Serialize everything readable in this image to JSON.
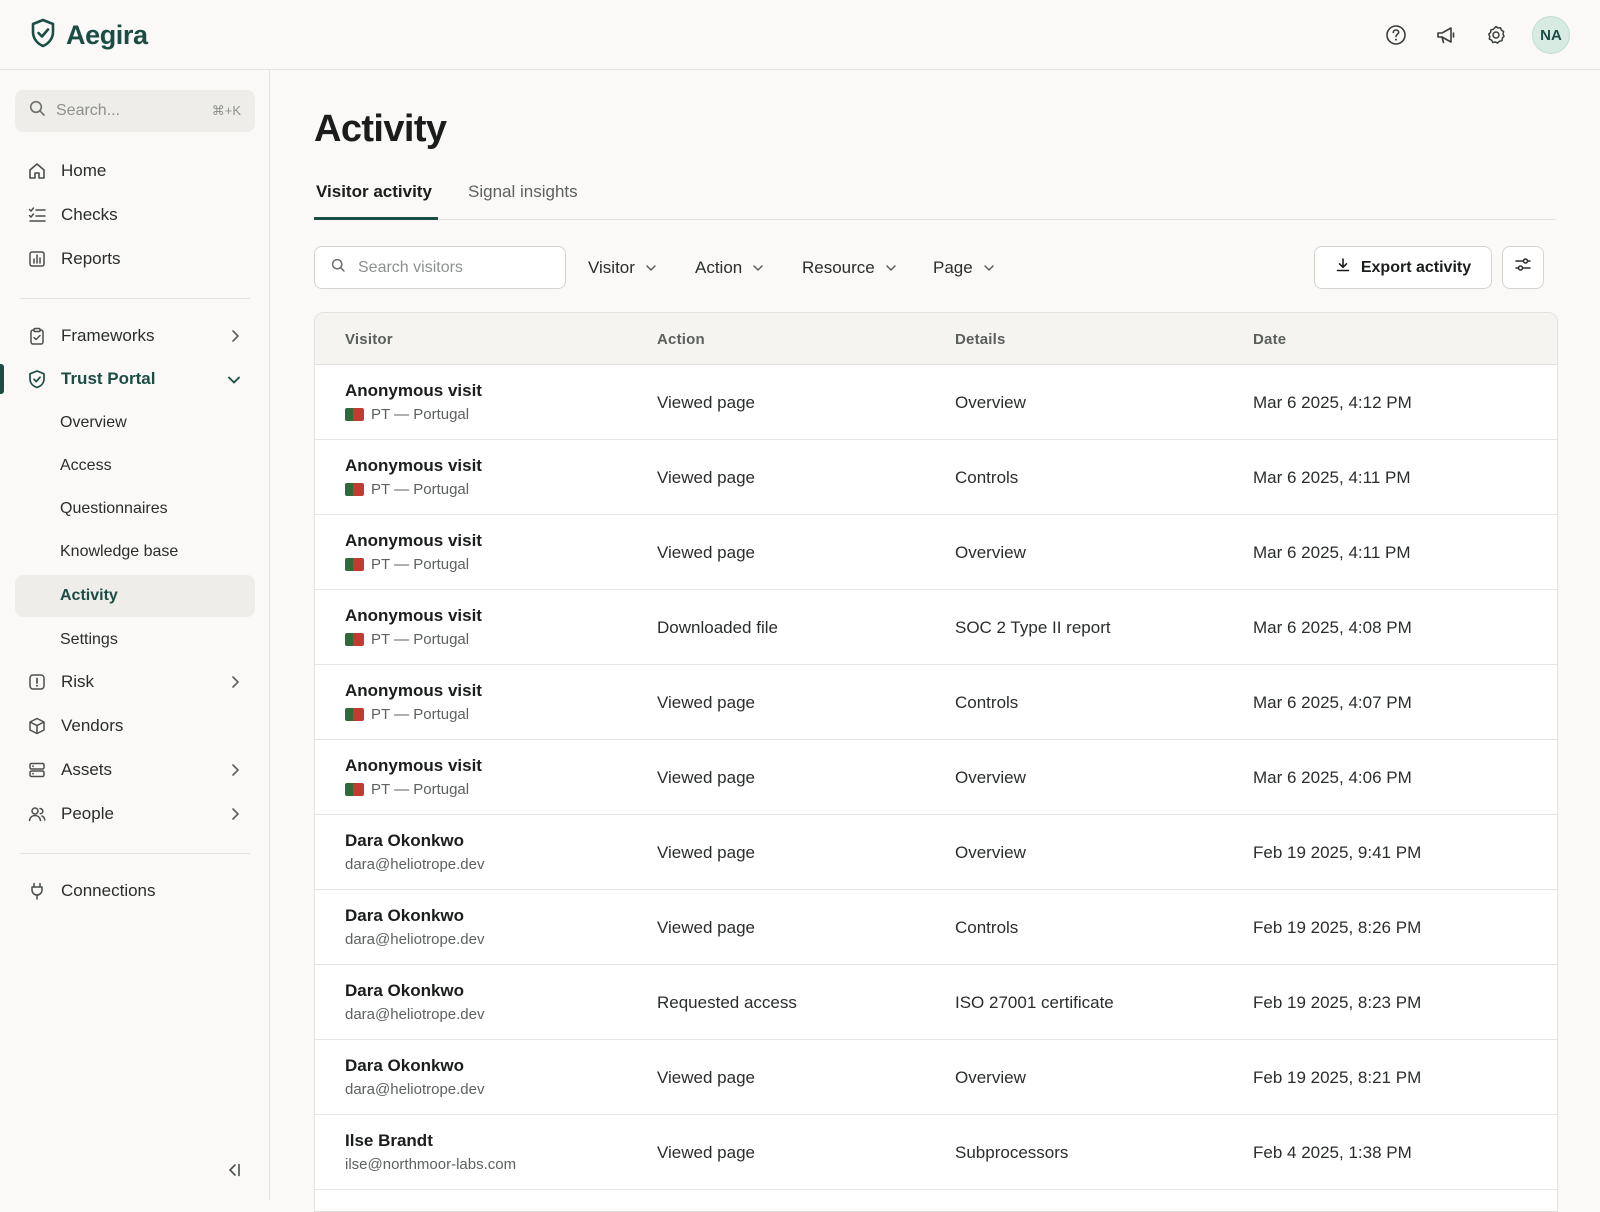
{
  "app": {
    "name": "Aegira",
    "avatar_initials": "NA"
  },
  "header_icons": [
    "help-icon",
    "megaphone-icon",
    "settings-icon"
  ],
  "sidebar": {
    "search_placeholder": "Search...",
    "search_shortcut": "⌘+K",
    "items": [
      {
        "label": "Home",
        "icon": "home-icon"
      },
      {
        "label": "Checks",
        "icon": "checklist-icon"
      },
      {
        "label": "Reports",
        "icon": "chart-icon"
      },
      {
        "label": "Frameworks",
        "icon": "clipboard-icon"
      },
      {
        "label": "Trust Portal",
        "icon": "shield-icon"
      },
      {
        "label": "Risk",
        "icon": "alert-icon"
      },
      {
        "label": "Vendors",
        "icon": "box-icon"
      },
      {
        "label": "Assets",
        "icon": "server-icon"
      },
      {
        "label": "People",
        "icon": "users-icon"
      },
      {
        "label": "Connections",
        "icon": "plug-icon"
      }
    ],
    "trust_portal_children": [
      "Overview",
      "Access",
      "Questionnaires",
      "Knowledge base",
      "Activity",
      "Settings"
    ],
    "active_child": "Activity"
  },
  "main": {
    "title": "Activity",
    "tabs": [
      {
        "label": "Visitor activity",
        "active": true
      },
      {
        "label": "Signal insights",
        "active": false
      }
    ],
    "toolbar": {
      "search_placeholder": "Search visitors",
      "filters": [
        "Visitor",
        "Action",
        "Resource",
        "Page"
      ],
      "export_label": "Export activity"
    },
    "table": {
      "columns": [
        "Visitor",
        "Action",
        "Details",
        "Date"
      ],
      "rows": [
        {
          "name": "Anonymous visit",
          "sub": "PT — Portugal",
          "flag": true,
          "action": "Viewed page",
          "details": "Overview",
          "date": "Mar 6 2025, 4:12 PM"
        },
        {
          "name": "Anonymous visit",
          "sub": "PT — Portugal",
          "flag": true,
          "action": "Viewed page",
          "details": "Controls",
          "date": "Mar 6 2025, 4:11 PM"
        },
        {
          "name": "Anonymous visit",
          "sub": "PT — Portugal",
          "flag": true,
          "action": "Viewed page",
          "details": "Overview",
          "date": "Mar 6 2025, 4:11 PM"
        },
        {
          "name": "Anonymous visit",
          "sub": "PT — Portugal",
          "flag": true,
          "action": "Downloaded file",
          "details": "SOC 2 Type II report",
          "date": "Mar 6 2025, 4:08 PM"
        },
        {
          "name": "Anonymous visit",
          "sub": "PT — Portugal",
          "flag": true,
          "action": "Viewed page",
          "details": "Controls",
          "date": "Mar 6 2025, 4:07 PM"
        },
        {
          "name": "Anonymous visit",
          "sub": "PT — Portugal",
          "flag": true,
          "action": "Viewed page",
          "details": "Overview",
          "date": "Mar 6 2025, 4:06 PM"
        },
        {
          "name": "Dara Okonkwo",
          "sub": "dara@heliotrope.dev",
          "flag": false,
          "action": "Viewed page",
          "details": "Overview",
          "date": "Feb 19 2025, 9:41 PM"
        },
        {
          "name": "Dara Okonkwo",
          "sub": "dara@heliotrope.dev",
          "flag": false,
          "action": "Viewed page",
          "details": "Controls",
          "date": "Feb 19 2025, 8:26 PM"
        },
        {
          "name": "Dara Okonkwo",
          "sub": "dara@heliotrope.dev",
          "flag": false,
          "action": "Requested access",
          "details": "ISO 27001 certificate",
          "date": "Feb 19 2025, 8:23 PM"
        },
        {
          "name": "Dara Okonkwo",
          "sub": "dara@heliotrope.dev",
          "flag": false,
          "action": "Viewed page",
          "details": "Overview",
          "date": "Feb 19 2025, 8:21 PM"
        },
        {
          "name": "Ilse Brandt",
          "sub": "ilse@northmoor-labs.com",
          "flag": false,
          "action": "Viewed page",
          "details": "Subprocessors",
          "date": "Feb 4 2025, 1:38 PM"
        }
      ]
    }
  },
  "colors": {
    "accent": "#1b4d45",
    "background": "#faf9f7",
    "border": "#e3e1dd"
  }
}
